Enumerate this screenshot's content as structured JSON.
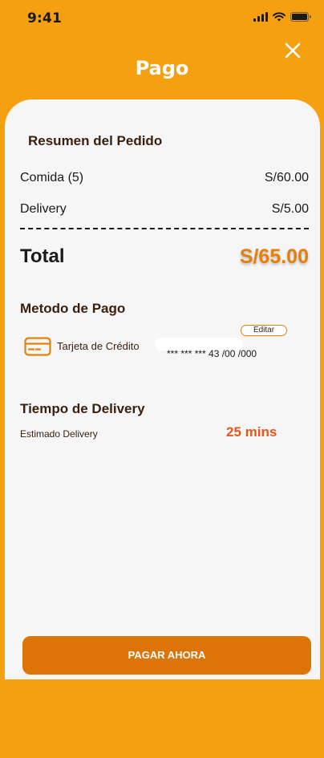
{
  "status": {
    "time": "9:41"
  },
  "header": {
    "title": "Pago"
  },
  "summary": {
    "title": "Resumen del Pedido",
    "items": [
      {
        "label": "Comida (5)",
        "value": "S/60.00"
      },
      {
        "label": "Delivery",
        "value": "S/5.00"
      }
    ],
    "total_label": "Total",
    "total_value": "S/65.00"
  },
  "payment": {
    "title": "Metodo de Pago",
    "edit_label": "Editar",
    "method_label": "Tarjeta de Crédito",
    "card_number": "*** *** *** 43 /00 /000"
  },
  "delivery": {
    "title": "Tiempo de Delivery",
    "estimate_label": "Estimado Delivery",
    "estimate_value": "25 mins"
  },
  "actions": {
    "pay_label": "PAGAR AHORA"
  },
  "colors": {
    "background": "#f5a010",
    "accent": "#e3800e",
    "button": "#dc7408",
    "time_accent": "#e4571e"
  },
  "icons": [
    "signal-icon",
    "wifi-icon",
    "battery-icon",
    "close-icon",
    "credit-card-icon"
  ]
}
